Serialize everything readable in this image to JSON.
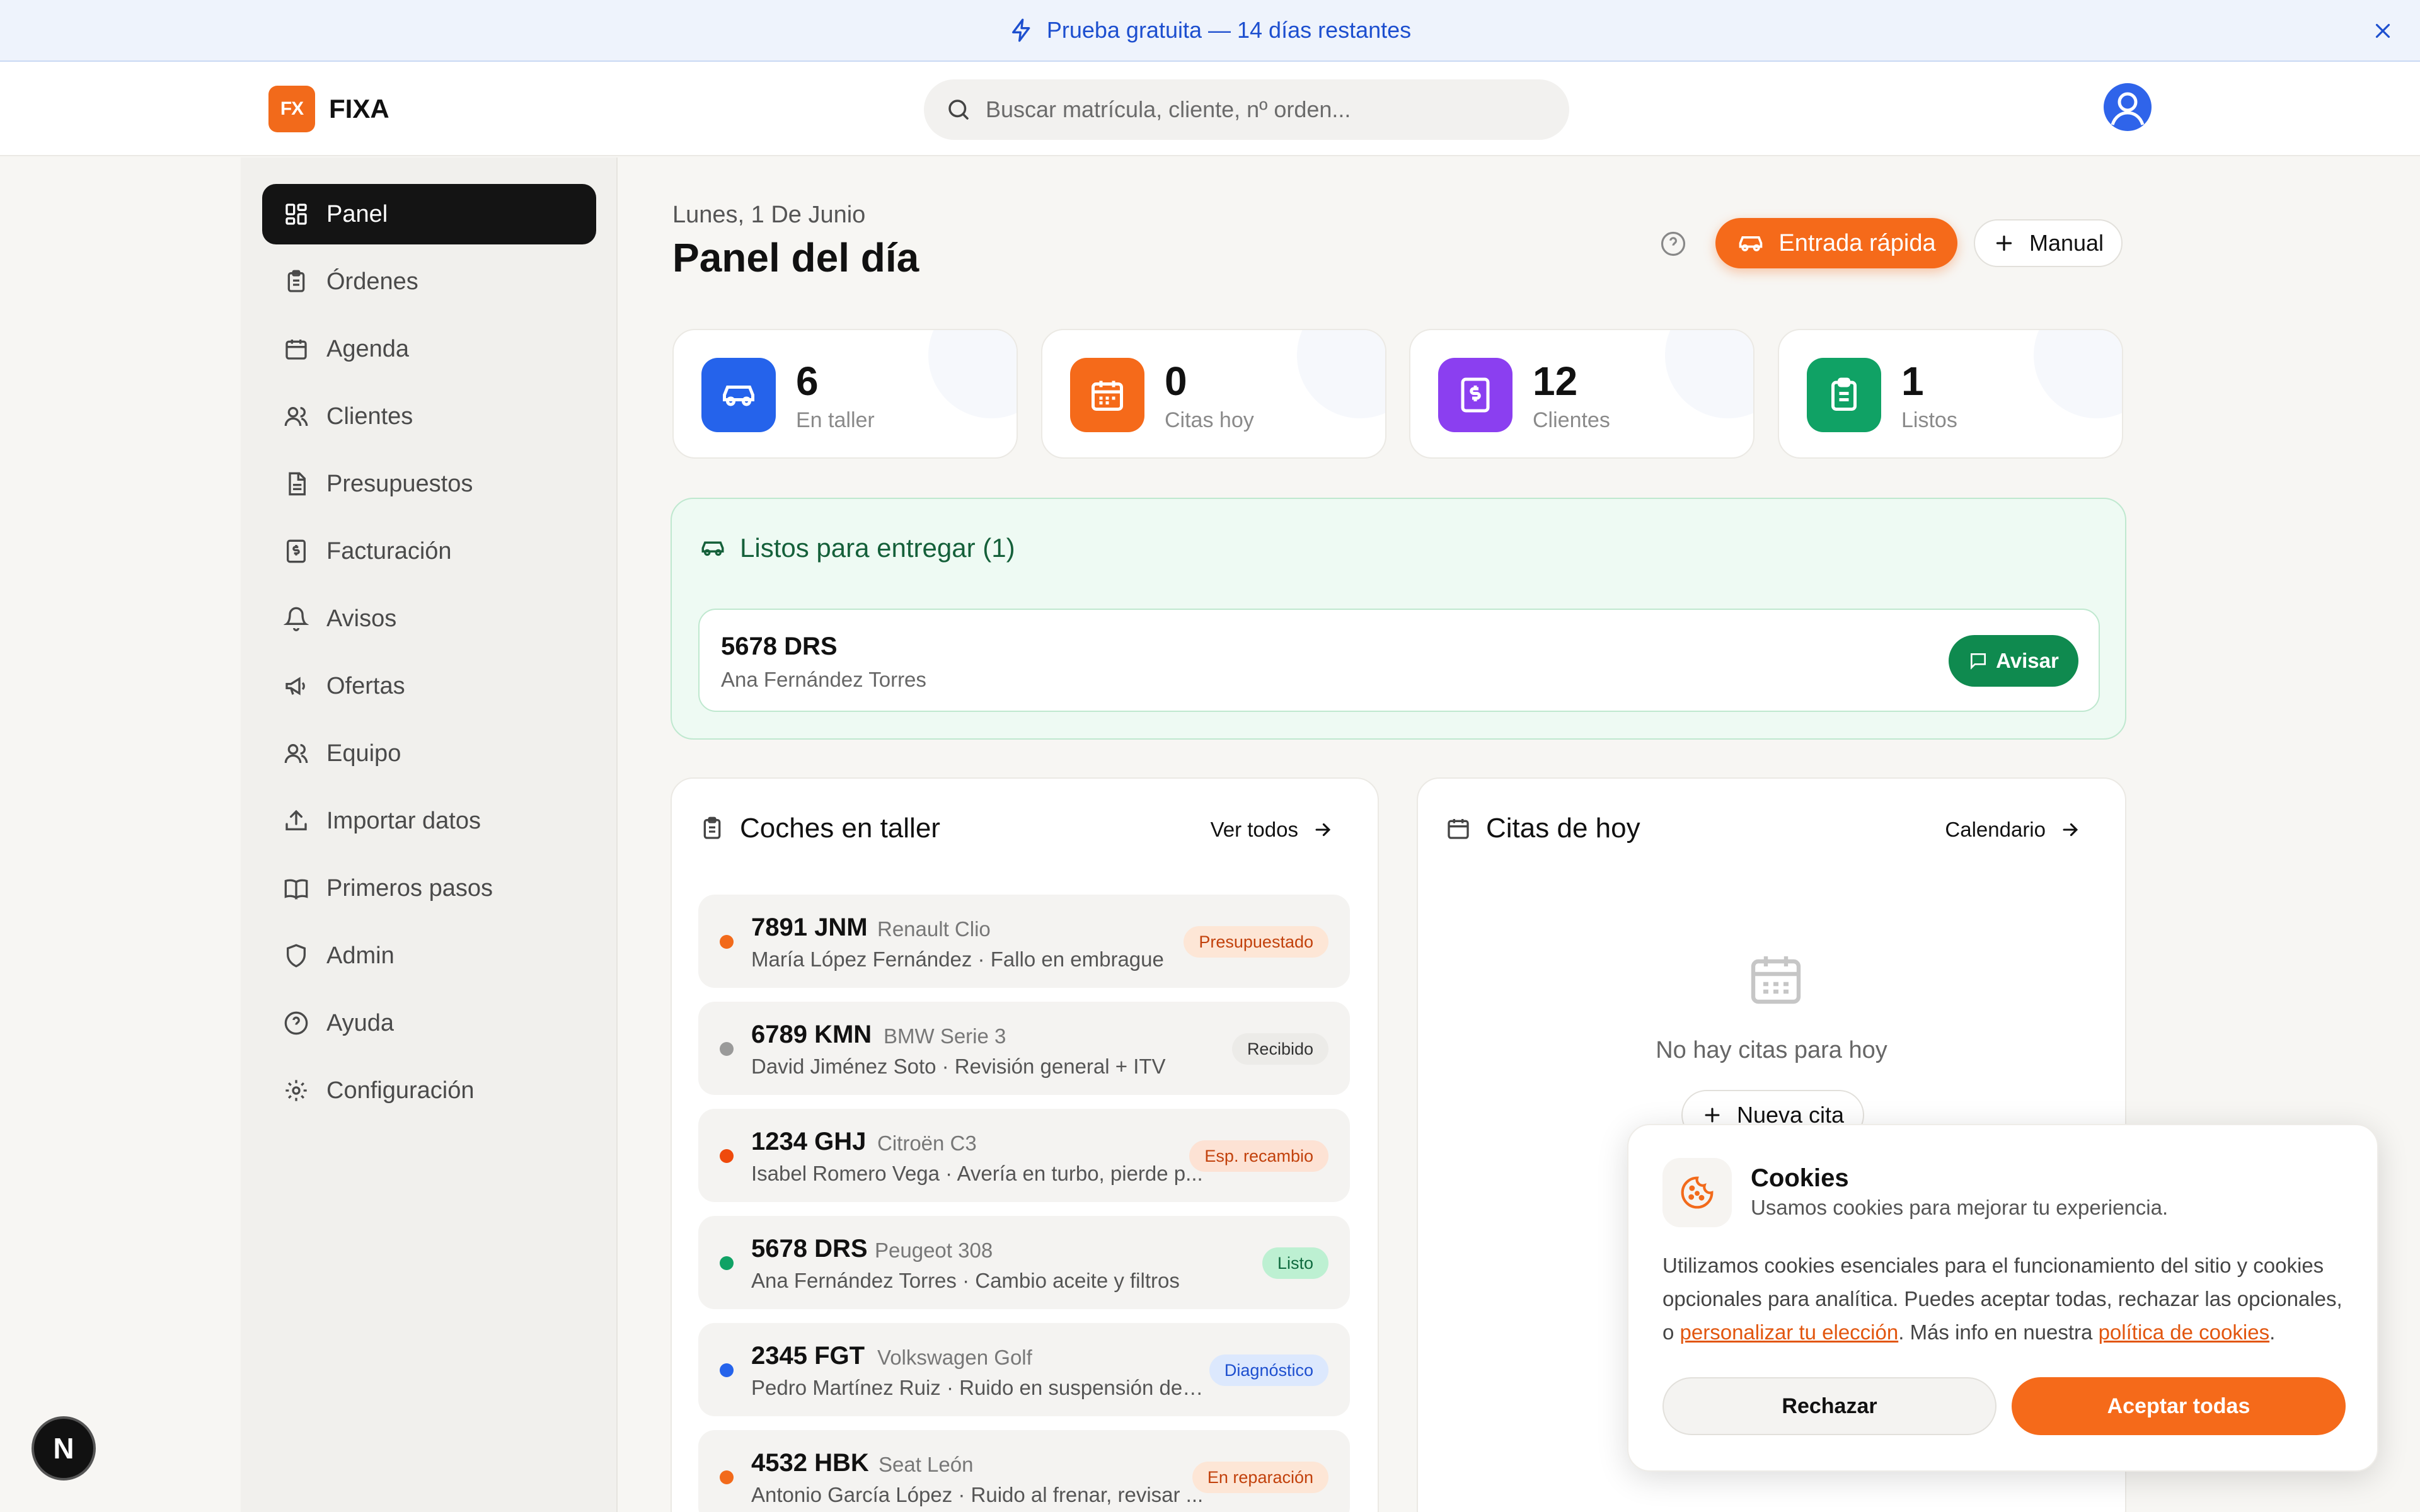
{
  "banner": {
    "text": "Prueba gratuita — 14 días restantes"
  },
  "header": {
    "logo_mark": "FX",
    "logo_text": "FIXA",
    "search_placeholder": "Buscar matrícula, cliente, nº orden..."
  },
  "sidebar": {
    "items": [
      {
        "label": "Panel",
        "icon": "grid-icon",
        "active": true
      },
      {
        "label": "Órdenes",
        "icon": "clipboard-icon"
      },
      {
        "label": "Agenda",
        "icon": "calendar-icon"
      },
      {
        "label": "Clientes",
        "icon": "users-icon"
      },
      {
        "label": "Presupuestos",
        "icon": "document-icon"
      },
      {
        "label": "Facturación",
        "icon": "invoice-icon"
      },
      {
        "label": "Avisos",
        "icon": "bell-icon"
      },
      {
        "label": "Ofertas",
        "icon": "megaphone-icon"
      },
      {
        "label": "Equipo",
        "icon": "team-icon"
      },
      {
        "label": "Importar datos",
        "icon": "upload-icon"
      },
      {
        "label": "Primeros pasos",
        "icon": "book-icon"
      },
      {
        "label": "Admin",
        "icon": "shield-icon"
      },
      {
        "label": "Ayuda",
        "icon": "help-icon"
      },
      {
        "label": "Configuración",
        "icon": "gear-icon"
      }
    ]
  },
  "main": {
    "date": "Lunes, 1 De Junio",
    "title": "Panel del día",
    "quick_entry_label": "Entrada rápida",
    "manual_label": "Manual"
  },
  "stats": [
    {
      "value": "6",
      "label": "En taller",
      "color": "#2563eb",
      "icon": "car-icon"
    },
    {
      "value": "0",
      "label": "Citas hoy",
      "color": "#f56a1a",
      "icon": "calendar-icon"
    },
    {
      "value": "12",
      "label": "Clientes",
      "color": "#8b3ff0",
      "icon": "invoice-icon"
    },
    {
      "value": "1",
      "label": "Listos",
      "color": "#10a265",
      "icon": "clipboard-icon"
    }
  ],
  "ready": {
    "title": "Listos para entregar (1)",
    "item": {
      "plate": "5678 DRS",
      "owner": "Ana Fernández Torres",
      "action": "Avisar"
    }
  },
  "workshop": {
    "title": "Coches en taller",
    "link": "Ver todos",
    "rows": [
      {
        "plate": "7891 JNM",
        "model": "Renault Clio",
        "sub": "María López Fernández · Fallo en embrague",
        "status": "Presupuestado",
        "dot": "#f26a1b",
        "badge_bg": "#fde6d6",
        "badge_fg": "#c2410c"
      },
      {
        "plate": "6789 KMN",
        "model": "BMW Serie 3",
        "sub": "David Jiménez Soto · Revisión general + ITV",
        "status": "Recibido",
        "dot": "#9a9a9a",
        "badge_bg": "#ecebe8",
        "badge_fg": "#333333"
      },
      {
        "plate": "1234 GHJ",
        "model": "Citroën C3",
        "sub": "Isabel Romero Vega · Avería en turbo, pierde p...",
        "status": "Esp. recambio",
        "dot": "#ef4a0c",
        "badge_bg": "#fde2d4",
        "badge_fg": "#c2410c"
      },
      {
        "plate": "5678 DRS",
        "model": "Peugeot 308",
        "sub": "Ana Fernández Torres · Cambio aceite y filtros",
        "status": "Listo",
        "dot": "#10a265",
        "badge_bg": "#bdf0d2",
        "badge_fg": "#0f6b3f"
      },
      {
        "plate": "2345 FGT",
        "model": "Volkswagen Golf",
        "sub": "Pedro Martínez Ruiz · Ruido en suspensión dela...",
        "status": "Diagnóstico",
        "dot": "#2563eb",
        "badge_bg": "#dce8fd",
        "badge_fg": "#1d4fcf"
      },
      {
        "plate": "4532 HBK",
        "model": "Seat León",
        "sub": "Antonio García López · Ruido al frenar, revisar ...",
        "status": "En reparación",
        "dot": "#f26a1b",
        "badge_bg": "#fde6d6",
        "badge_fg": "#c2410c"
      }
    ]
  },
  "appointments": {
    "title": "Citas de hoy",
    "link": "Calendario",
    "empty": "No hay citas para hoy",
    "new_label": "Nueva cita"
  },
  "cookies": {
    "title": "Cookies",
    "subtitle": "Usamos cookies para mejorar tu experiencia.",
    "body_1": "Utilizamos cookies esenciales para el funcionamiento del sitio y cookies opcionales para analítica. Puedes aceptar todas, rechazar las opcionales, o ",
    "link_1": "personalizar tu elección",
    "body_2": ". Más info en nuestra ",
    "link_2": "política de cookies",
    "body_3": ".",
    "reject": "Rechazar",
    "accept": "Aceptar todas"
  },
  "dev_badge": "N"
}
